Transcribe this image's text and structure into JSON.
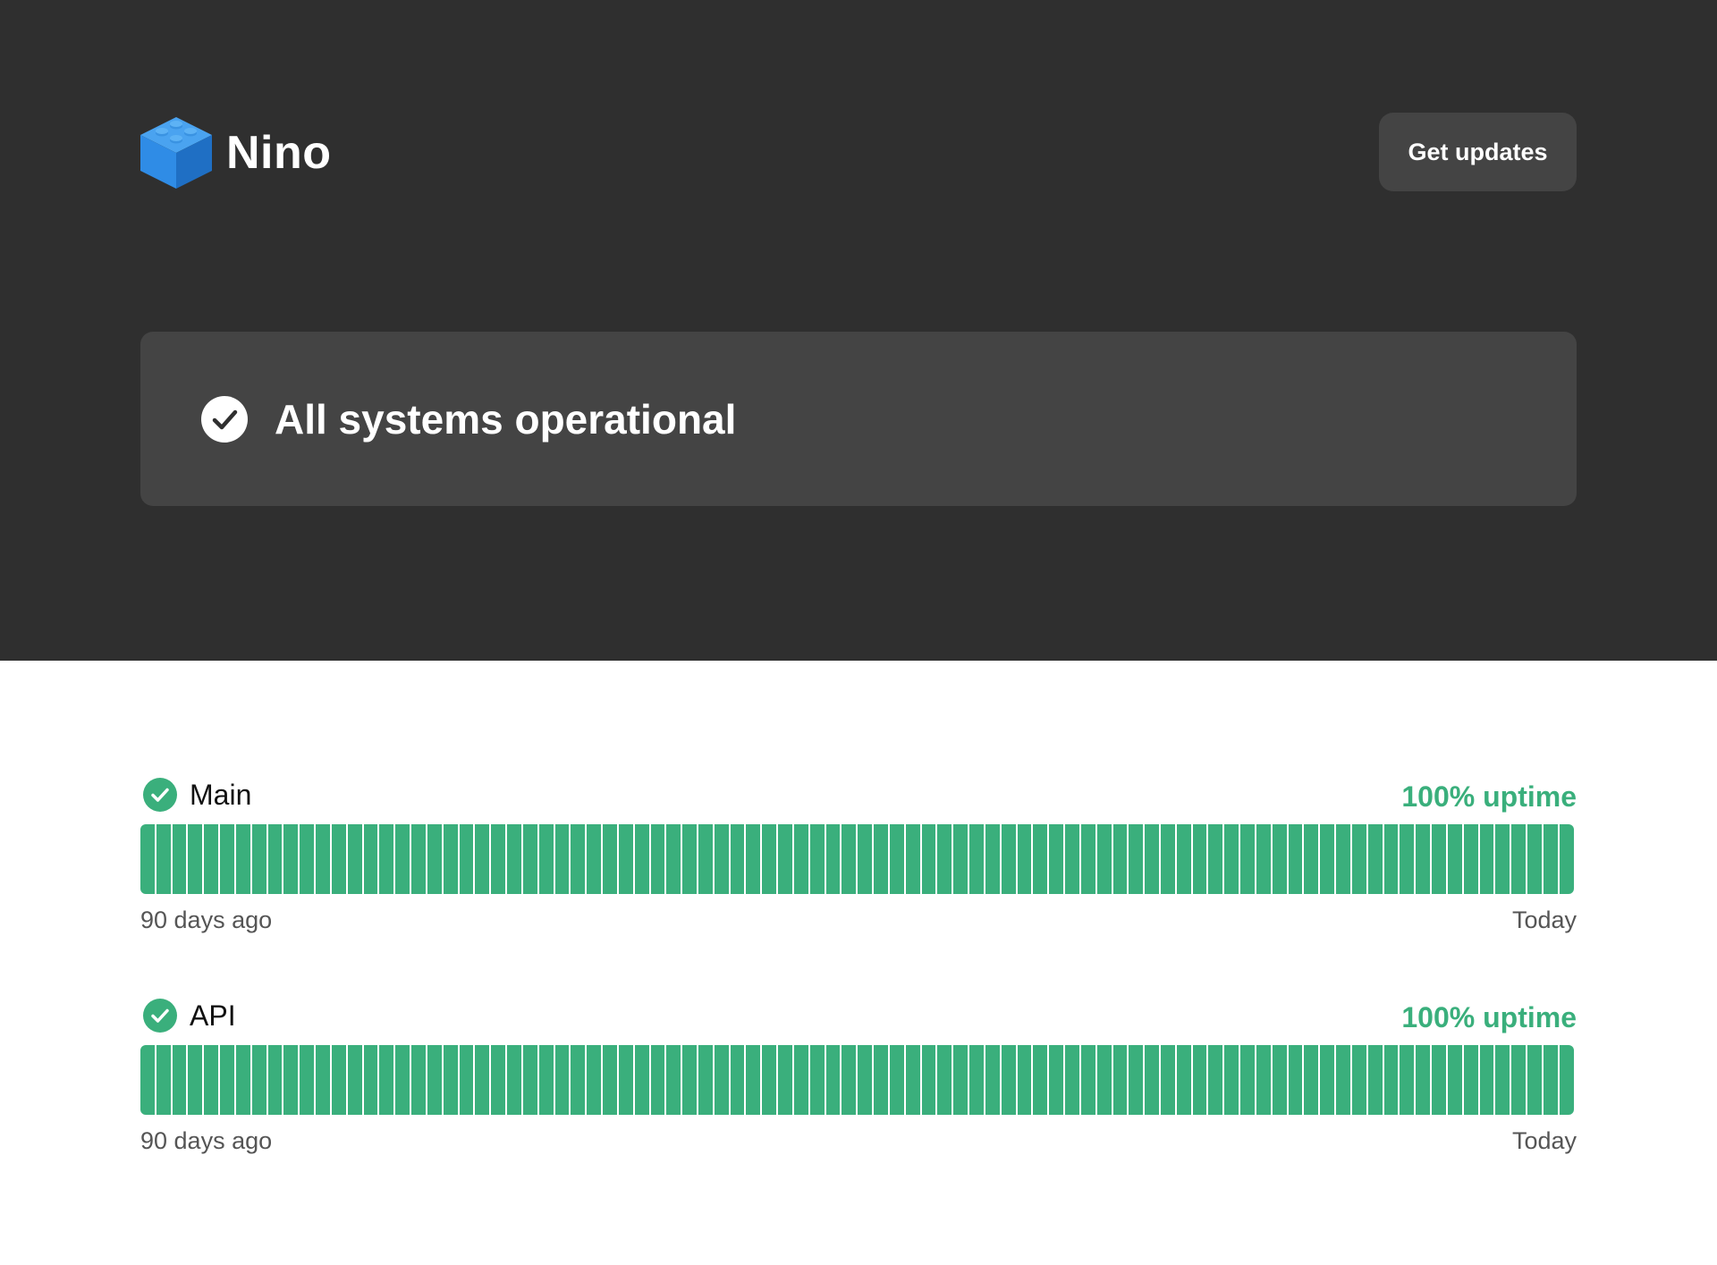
{
  "header": {
    "brand_name": "Nino",
    "logo_icon": "lego-brick-icon",
    "get_updates_label": "Get updates"
  },
  "status": {
    "icon": "check-circle-icon",
    "text": "All systems operational"
  },
  "components": [
    {
      "name": "Main",
      "status_icon": "check-circle-icon",
      "uptime": "100% uptime",
      "uptime_percent": 100,
      "range_start": "90 days ago",
      "range_end": "Today",
      "days": 90
    },
    {
      "name": "API",
      "status_icon": "check-circle-icon",
      "uptime": "100% uptime",
      "uptime_percent": 100,
      "range_start": "90 days ago",
      "range_end": "Today",
      "days": 90
    }
  ],
  "colors": {
    "hero_background": "#2f2f2f",
    "panel_background": "#444444",
    "operational_green": "#3aaf7c",
    "logo_blue": "#2f8ce6"
  }
}
